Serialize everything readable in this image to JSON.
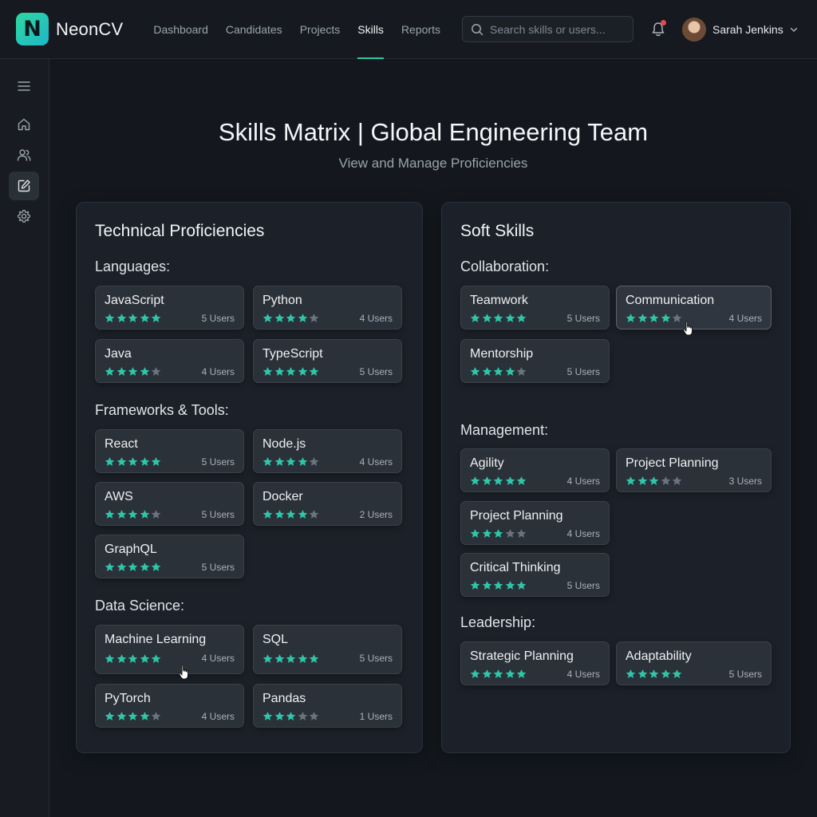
{
  "app": {
    "name": "NeonCV",
    "logo_letter": "N",
    "accent": "#2ec6a8"
  },
  "nav": {
    "items": [
      {
        "label": "Dashboard",
        "active": false
      },
      {
        "label": "Candidates",
        "active": false
      },
      {
        "label": "Projects",
        "active": false
      },
      {
        "label": "Skills",
        "active": true
      },
      {
        "label": "Reports",
        "active": false
      }
    ]
  },
  "search": {
    "placeholder": "Search skills or users..."
  },
  "notifications": {
    "icon": "bell-icon",
    "has_unread": true,
    "badge_color": "#e5484d"
  },
  "user": {
    "name": "Sarah Jenkins"
  },
  "sidebar": {
    "items": [
      {
        "icon": "menu-icon",
        "active": false
      },
      {
        "icon": "home-icon",
        "active": false
      },
      {
        "icon": "users-icon",
        "active": false
      },
      {
        "icon": "edit-icon",
        "active": true
      },
      {
        "icon": "gear-icon",
        "active": false
      }
    ]
  },
  "page": {
    "title": "Skills Matrix | Global Engineering Team",
    "subtitle": "View and Manage Proficiencies"
  },
  "technical": {
    "title": "Technical Proficiencies",
    "groups": [
      {
        "title": "Languages:",
        "skills": [
          {
            "name": "JavaScript",
            "rating": 5,
            "users": "5 Users"
          },
          {
            "name": "Python",
            "rating": 4,
            "users": "4 Users"
          },
          {
            "name": "Java",
            "rating": 4,
            "users": "4 Users"
          },
          {
            "name": "TypeScript",
            "rating": 5,
            "users": "5 Users"
          }
        ]
      },
      {
        "title": "Frameworks & Tools:",
        "skills": [
          {
            "name": "React",
            "rating": 5,
            "users": "5 Users"
          },
          {
            "name": "Node.js",
            "rating": 4,
            "users": "4 Users"
          },
          {
            "name": "AWS",
            "rating": 4,
            "users": "5 Users"
          },
          {
            "name": "Docker",
            "rating": 4,
            "users": "2 Users"
          },
          {
            "name": "GraphQL",
            "rating": 5,
            "users": "5 Users"
          }
        ]
      },
      {
        "title": "Data Science:",
        "skills": [
          {
            "name": "Machine Learning",
            "rating": 5,
            "users": "4 Users"
          },
          {
            "name": "SQL",
            "rating": 5,
            "users": "5 Users"
          },
          {
            "name": "PyTorch",
            "rating": 4,
            "users": "4 Users"
          },
          {
            "name": "Pandas",
            "rating": 3,
            "users": "1 Users"
          }
        ]
      }
    ]
  },
  "soft": {
    "title": "Soft Skills",
    "groups": [
      {
        "title": "Collaboration:",
        "skills": [
          {
            "name": "Teamwork",
            "rating": 5,
            "users": "5 Users"
          },
          {
            "name": "Communication",
            "rating": 4,
            "users": "4 Users"
          },
          {
            "name": "Mentorship",
            "rating": 4,
            "users": "5 Users"
          }
        ]
      },
      {
        "title": "Management:",
        "skills": [
          {
            "name": "Agility",
            "rating": 5,
            "users": "4 Users"
          },
          {
            "name": "Project Planning",
            "rating": 3,
            "users": "3 Users"
          },
          {
            "name": "Project Planning",
            "rating": 3,
            "users": "4 Users"
          },
          {
            "name": "Critical Thinking",
            "rating": 5,
            "users": "5 Users"
          }
        ]
      },
      {
        "title": "Leadership:",
        "skills": [
          {
            "name": "Strategic Planning",
            "rating": 5,
            "users": "4 Users"
          },
          {
            "name": "Adaptability",
            "rating": 5,
            "users": "5 Users"
          }
        ]
      }
    ]
  },
  "colors": {
    "star_filled": "#2ec6a8",
    "star_empty": "#6b737d"
  }
}
